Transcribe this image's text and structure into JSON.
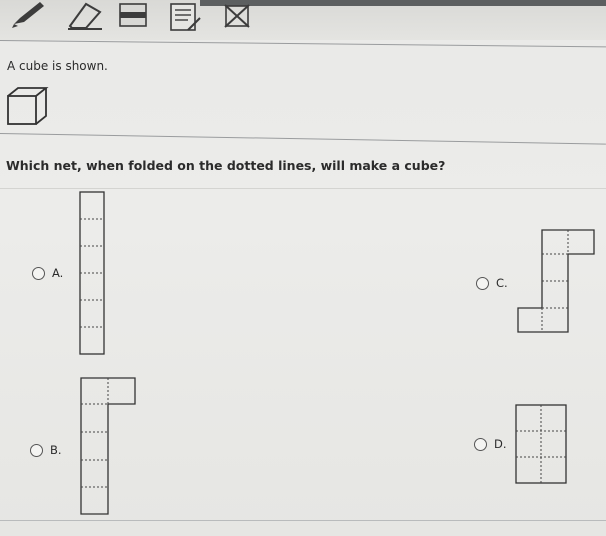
{
  "toolbar": {
    "tools": [
      {
        "name": "pencil-icon"
      },
      {
        "name": "eraser-icon"
      },
      {
        "name": "line-reader-icon"
      },
      {
        "name": "notepad-icon"
      },
      {
        "name": "answer-eliminator-icon"
      }
    ]
  },
  "stem": {
    "text": "A cube is shown.",
    "figure": "cube-icon"
  },
  "question": {
    "text": "Which net, when folded on the dotted lines, will make a cube?"
  },
  "options": [
    {
      "id": "A",
      "label": "A."
    },
    {
      "id": "B",
      "label": "B."
    },
    {
      "id": "C",
      "label": "C."
    },
    {
      "id": "D",
      "label": "D."
    }
  ]
}
